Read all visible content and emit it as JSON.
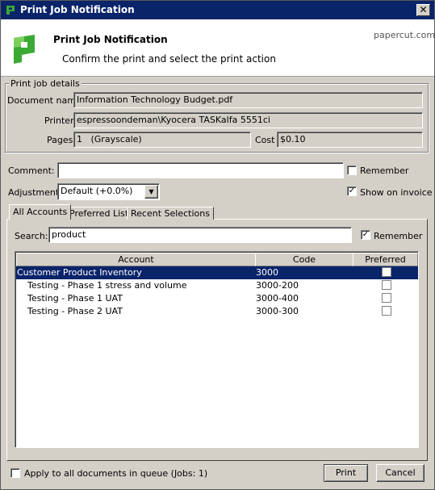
{
  "window": {
    "title": "Print Job Notification",
    "close_label": "✕"
  },
  "header": {
    "title": "Print Job Notification",
    "subtitle": "Confirm the print and select the print action",
    "brand": "papercut.com"
  },
  "details": {
    "group_label": "Print job details",
    "document_name_label": "Document name",
    "document_name": "Information Technology Budget.pdf",
    "printer_label": "Printer",
    "printer": "espressoondeman\\Kyocera TASKalfa 5551ci",
    "pages_label": "Pages",
    "pages": "1   (Grayscale)",
    "cost_label": "Cost",
    "cost": "$0.10"
  },
  "comment": {
    "label": "Comment:",
    "value": "",
    "remember_label": "Remember",
    "remember_checked": false
  },
  "adjustment": {
    "label": "Adjustment:",
    "value": "Default (+0.0%)",
    "show_on_invoice_label": "Show on invoice",
    "show_on_invoice_checked": true
  },
  "tabs": [
    {
      "label": "All Accounts",
      "active": true
    },
    {
      "label": "Preferred List",
      "active": false
    },
    {
      "label": "Recent Selections",
      "active": false
    }
  ],
  "search": {
    "label": "Search:",
    "value": "product",
    "remember_label": "Remember",
    "remember_checked": true
  },
  "table": {
    "columns": [
      "Account",
      "Code",
      "Preferred"
    ],
    "rows": [
      {
        "account": "Customer Product Inventory",
        "code": "3000",
        "preferred": false,
        "selected": true
      },
      {
        "account": "Testing - Phase 1 stress and volume",
        "code": "3000-200",
        "preferred": false,
        "selected": false
      },
      {
        "account": "Testing - Phase 1 UAT",
        "code": "3000-400",
        "preferred": false,
        "selected": false
      },
      {
        "account": "Testing - Phase 2 UAT",
        "code": "3000-300",
        "preferred": false,
        "selected": false
      }
    ]
  },
  "footer": {
    "apply_all_label": "Apply to all documents in queue (Jobs: 1)",
    "apply_all_checked": false,
    "print_label": "Print",
    "cancel_label": "Cancel"
  },
  "colors": {
    "titlebar": "#0a246a",
    "selection": "#0a246a",
    "face": "#d4d0c8",
    "logo_green": "#3aaa35"
  },
  "icons": {
    "app": "papercut-logo-icon",
    "dropdown": "chevron-down-icon"
  }
}
